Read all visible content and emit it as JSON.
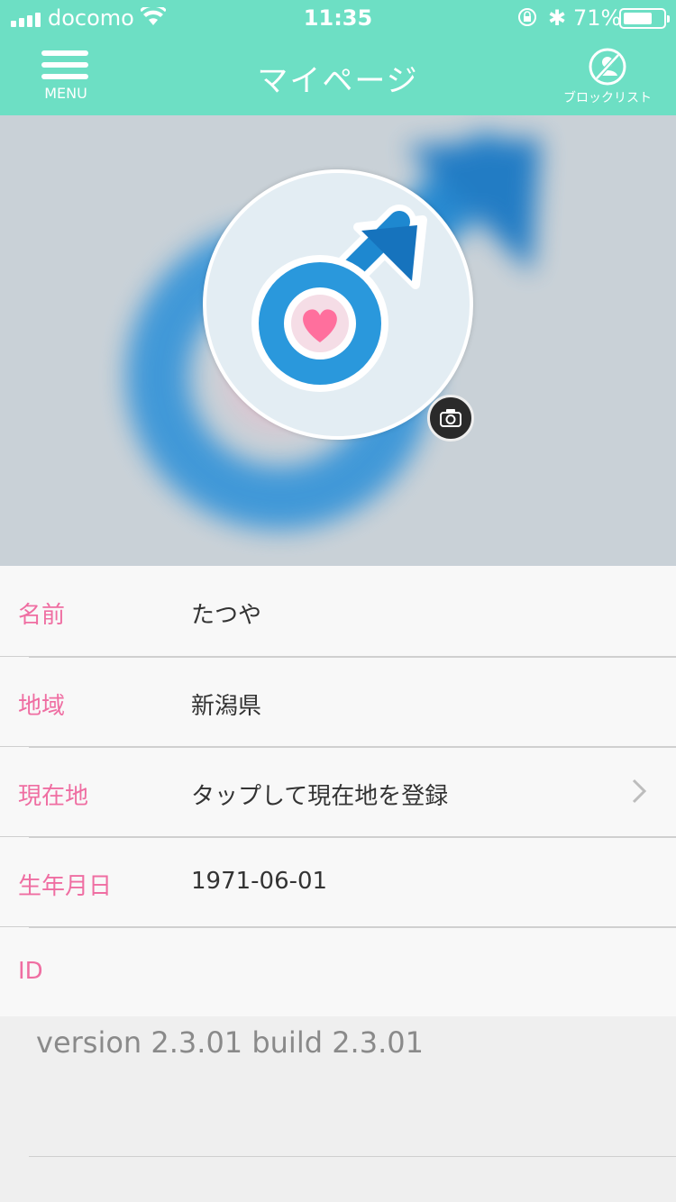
{
  "status_bar": {
    "carrier": "docomo",
    "time": "11:35",
    "battery": "71%",
    "battery_level": 0.71
  },
  "nav": {
    "menu_label": "MENU",
    "title": "マイページ",
    "block_list_label": "ブロックリスト"
  },
  "profile": {
    "rows": [
      {
        "label": "名前",
        "value": "たつや"
      },
      {
        "label": "地域",
        "value": "新潟県"
      },
      {
        "label": "現在地",
        "value": "タップして現在地を登録"
      },
      {
        "label": "生年月日",
        "value": "1971-06-01"
      },
      {
        "label": "ID",
        "value": ""
      }
    ]
  },
  "version_text": "version 2.3.01 build 2.3.01",
  "colors": {
    "header": "#6ddfc4",
    "label_pink": "#ef6ea2",
    "icon_blue": "#1e88d0",
    "heart_pink": "#ff6f9d"
  }
}
